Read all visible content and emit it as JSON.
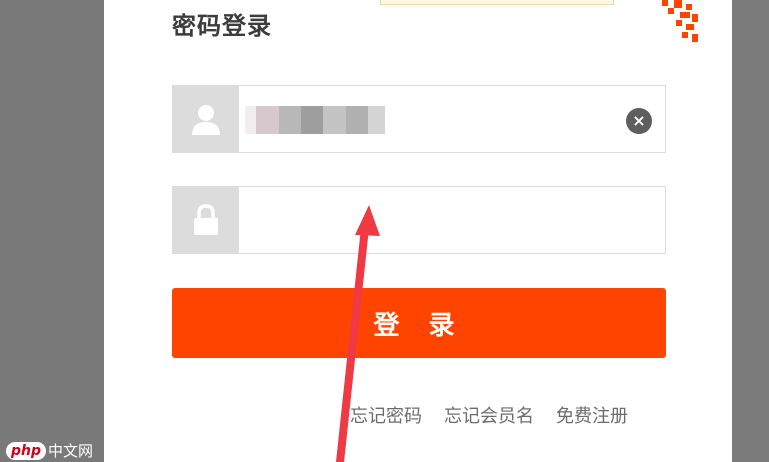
{
  "form": {
    "title": "密码登录",
    "username": {
      "placeholder": "",
      "value_masked": true
    },
    "password": {
      "placeholder": "",
      "value": ""
    },
    "submit_label": "登 录"
  },
  "links": {
    "forgot_password": "忘记密码",
    "forgot_member_name": "忘记会员名",
    "free_register": "免费注册"
  },
  "icons": {
    "user": "user-icon",
    "lock": "lock-icon",
    "clear": "clear-icon",
    "qr": "qr-code-corner-icon"
  },
  "colors": {
    "accent": "#ff4400",
    "annotation_arrow": "#ef3a44",
    "overlay": "#797979"
  },
  "watermark": {
    "badge": "php",
    "text": "中文网"
  }
}
